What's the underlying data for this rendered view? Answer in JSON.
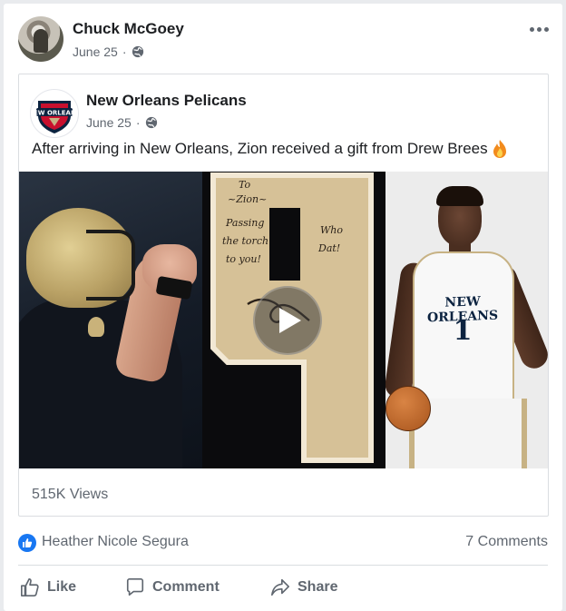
{
  "post": {
    "author": "Chuck McGoey",
    "date": "June 25",
    "separator": "·",
    "privacy_icon": "globe-icon",
    "more_icon": "more-dots-icon"
  },
  "shared_post": {
    "page_name": "New Orleans Pelicans",
    "date": "June 25",
    "separator": "·",
    "caption": "After arriving in New Orleans, Zion received a gift from Drew Brees",
    "caption_emoji": "fire-icon",
    "video": {
      "play_icon": "play-icon",
      "jersey_text": "NEW ORLEANS",
      "jersey_number": "1"
    },
    "views": "515K Views"
  },
  "reactions": {
    "reaction_icon": "like-icon",
    "reactor": "Heather Nicole Segura",
    "comments": "7 Comments"
  },
  "actions": {
    "like": "Like",
    "comment": "Comment",
    "share": "Share"
  },
  "colors": {
    "accent": "#1877f2",
    "secondary_text": "#606770",
    "gold": "#c7b284",
    "navy": "#0c2340"
  }
}
